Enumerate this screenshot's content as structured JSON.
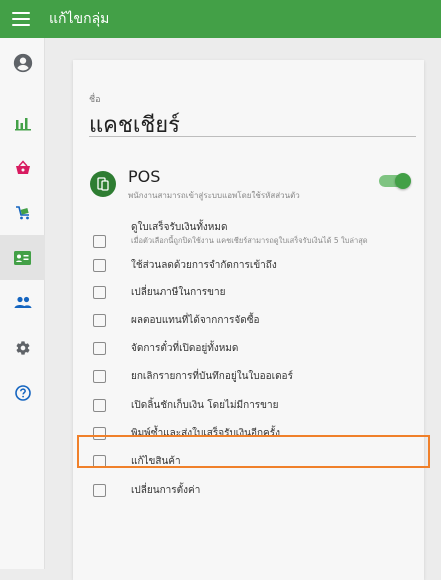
{
  "header": {
    "title": "แก้ไขกลุ่ม"
  },
  "sidebar": {
    "items": [
      {
        "name": "account",
        "icon": "account-circle-icon"
      },
      {
        "name": "reports",
        "icon": "bar-chart-icon"
      },
      {
        "name": "items",
        "icon": "basket-icon"
      },
      {
        "name": "inventory",
        "icon": "cart-icon"
      },
      {
        "name": "employees",
        "icon": "id-card-icon",
        "active": true
      },
      {
        "name": "customers",
        "icon": "people-icon"
      },
      {
        "name": "settings",
        "icon": "gear-icon"
      },
      {
        "name": "help",
        "icon": "help-icon"
      }
    ]
  },
  "form": {
    "name_label": "ชื่อ",
    "name_value": "แคชเชียร์"
  },
  "pos": {
    "title": "POS",
    "description": "พนักงานสามารถเข้าสู่ระบบแอพโดยใช้รหัสส่วนตัว",
    "enabled": true
  },
  "permissions": [
    {
      "label": "ดูใบเสร็จรับเงินทั้งหมด",
      "sub": "เมื่อตัวเลือกนี้ถูกปิดใช้งาน แคชเชียร์สามารถดูใบเสร็จรับเงินได้ 5 ใบล่าสุด",
      "checked": false
    },
    {
      "label": "ใช้ส่วนลดด้วยการจำกัดการเข้าถึง",
      "checked": false
    },
    {
      "label": "เปลี่ยนภาษีในการขาย",
      "checked": false
    },
    {
      "label": "ผลตอบแทนที่ได้จากการจัดซื้อ",
      "checked": false
    },
    {
      "label": "จัดการตั๋วที่เปิดอยู่ทั้งหมด",
      "checked": false
    },
    {
      "label": "ยกเลิกรายการที่บันทึกอยู่ในใบออเดอร์",
      "checked": false,
      "highlighted": true
    },
    {
      "label": "เปิดลิ้นชักเก็บเงิน โดยไม่มีการขาย",
      "checked": false
    },
    {
      "label": "พิมพ์ซ้ำและส่งใบเสร็จรับเงินอีกครั้ง",
      "checked": false
    },
    {
      "label": "แก้ไขสินค้า",
      "checked": false
    },
    {
      "label": "เปลี่ยนการตั้งค่า",
      "checked": false
    }
  ],
  "colors": {
    "topbar": "#43a047",
    "accent": "#43a047",
    "highlight": "#f0802a",
    "icon_green": "#43a047",
    "icon_blue": "#1565c0"
  }
}
